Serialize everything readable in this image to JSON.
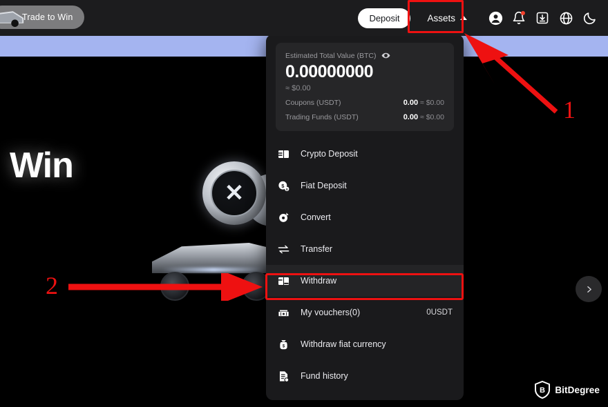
{
  "topbar": {
    "trade_pill_label": "Trade to Win",
    "deposit_label": "Deposit",
    "assets_label": "Assets",
    "icons": [
      {
        "name": "account-icon",
        "glyph": "account"
      },
      {
        "name": "notification-bell-icon",
        "glyph": "bell"
      },
      {
        "name": "download-app-icon",
        "glyph": "download"
      },
      {
        "name": "language-globe-icon",
        "glyph": "globe"
      },
      {
        "name": "theme-toggle-icon",
        "glyph": "moon"
      }
    ]
  },
  "hero": {
    "title": "Win",
    "banner_color": "#a4b4f0",
    "next_label": "›"
  },
  "panel": {
    "balance": {
      "label": "Estimated Total Value (BTC)",
      "eye_icon": "eye-icon",
      "amount": "0.00000000",
      "approx": "≈ $0.00",
      "rows": [
        {
          "key": "Coupons  (USDT)",
          "value": "0.00",
          "approx": "≈ $0.00"
        },
        {
          "key": "Trading Funds  (USDT)",
          "value": "0.00",
          "approx": "≈ $0.00"
        }
      ]
    },
    "menu": [
      {
        "id": "crypto-deposit",
        "label": "Crypto Deposit",
        "icon": "crypto-deposit-icon",
        "value": "",
        "active": false
      },
      {
        "id": "fiat-deposit",
        "label": "Fiat Deposit",
        "icon": "fiat-deposit-icon",
        "value": "",
        "active": false
      },
      {
        "id": "convert",
        "label": "Convert",
        "icon": "convert-icon",
        "value": "",
        "active": false
      },
      {
        "id": "transfer",
        "label": "Transfer",
        "icon": "transfer-icon",
        "value": "",
        "active": false
      },
      {
        "id": "withdraw",
        "label": "Withdraw",
        "icon": "withdraw-icon",
        "value": "",
        "active": true
      },
      {
        "id": "my-vouchers",
        "label": "My vouchers(0)",
        "icon": "voucher-icon",
        "value": "0USDT",
        "active": false
      },
      {
        "id": "withdraw-fiat",
        "label": "Withdraw fiat currency",
        "icon": "fiat-withdraw-icon",
        "value": "",
        "active": false
      },
      {
        "id": "fund-history",
        "label": "Fund history",
        "icon": "fund-history-icon",
        "value": "",
        "active": false
      }
    ]
  },
  "annotations": {
    "color": "#ee1111",
    "step1": "1",
    "step2": "2"
  },
  "watermark": {
    "text": "BitDegree",
    "logo_letter": "B"
  }
}
